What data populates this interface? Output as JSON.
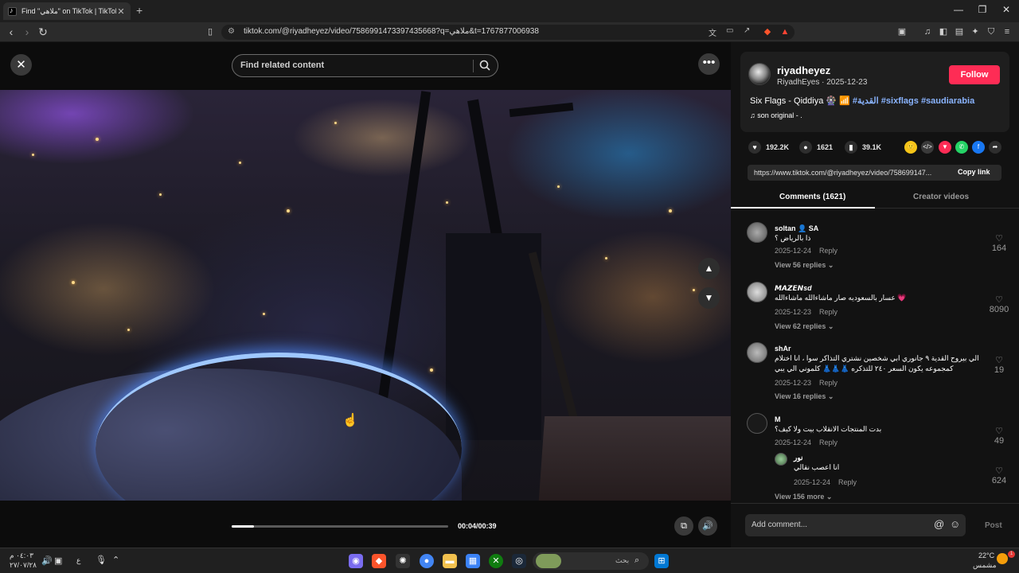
{
  "browser": {
    "tab_title": "Find \"ملاهي\" on TikTok | TikTok",
    "tab_close": "✕",
    "new_tab": "+",
    "url": "tiktok.com/@riyadheyez/video/7586991473397435668?q=ملاهي&t=1767877006938",
    "window_minimize": "—",
    "window_restore": "❐",
    "window_close": "✕"
  },
  "video_header": {
    "close": "✕",
    "search_placeholder": "Find related content",
    "more": "•••"
  },
  "player": {
    "progress_fraction": 0.1026,
    "time": "00:04/00:39"
  },
  "author": {
    "username": "riyadheyez",
    "subline": "RiyadhEyes · 2025-12-23",
    "follow_label": "Follow"
  },
  "post": {
    "caption_prefix": "Six Flags - Qiddiya 🎡 📶",
    "hashtags": [
      "#القدية",
      "#sixflags",
      "#saudiarabia"
    ],
    "music": "son original - ."
  },
  "stats": {
    "likes": "192.2K",
    "comments": "1621",
    "saves": "39.1K"
  },
  "share_icons": [
    "🙂",
    "</>",
    "▼",
    "✆",
    "f",
    "➦"
  ],
  "share_colors": [
    "#f5c518",
    "#3a3a3a",
    "#fe2c55",
    "#25d366",
    "#1877f2",
    "#2e2e2e"
  ],
  "link": {
    "url": "https://www.tiktok.com/@riyadheyez/video/758699147...",
    "copy_label": "Copy link"
  },
  "panel_tabs": {
    "comments": "Comments (1621)",
    "creator_videos": "Creator videos"
  },
  "comments": [
    {
      "user": "soltan 👤 SA",
      "text": "ذا بالرياض ؟",
      "date": "2025-12-24",
      "reply": "Reply",
      "more": "View 56 replies ⌄",
      "likes": "164"
    },
    {
      "user": "𝙈𝘼𝙕𝙀𝙉sd",
      "text": "💗 عسار بالسعوديه صار ماشاءالله ماشاءالله",
      "date": "2025-12-23",
      "reply": "Reply",
      "more": "View 62 replies ⌄",
      "likes": "8090"
    },
    {
      "user": "shAr",
      "text": "الي بيروح القدية ٩ جانوري ابي شخصين نشتري التذاكر سوا ، انا اختلام",
      "text2": "كمجموعه يكون السعر ٢٤٠ للتذكره 👗👗👗 كلموني الي يبي",
      "date": "2025-12-23",
      "reply": "Reply",
      "more": "View 16 replies ⌄",
      "likes": "19"
    },
    {
      "user": "M",
      "text": "بدت المنتجات الانقلاب بيت ولا كيف؟",
      "date": "2025-12-24",
      "reply": "Reply",
      "more": "",
      "likes": "49"
    },
    {
      "user": "نور",
      "text": "انا اعصب نقالي",
      "date": "2025-12-24",
      "reply": "Reply",
      "more": "View 156 more ⌄",
      "likes": "624"
    }
  ],
  "comment_bar": {
    "placeholder": "Add comment...",
    "at": "@",
    "emoji": "☺",
    "post": "Post"
  },
  "taskbar": {
    "clock_time": "٠٤:٠٣ م",
    "clock_date": "٢٧/٠٧/٢٨",
    "lang": "ع",
    "search_label": "بحث",
    "weather_temp": "22°C",
    "weather_desc": "مشمس"
  }
}
